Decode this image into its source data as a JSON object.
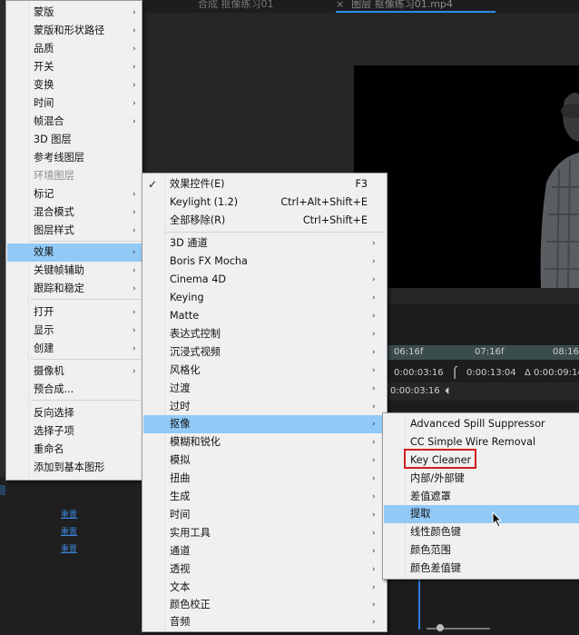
{
  "tabs": {
    "tab1": "合成 抠像练习01",
    "tab2_close": "×",
    "tab2": "图层 抠像练习01.mp4"
  },
  "timeline": {
    "ruler": [
      "06:16f",
      "07:16f",
      "08:16f"
    ],
    "tc_start": "0:00:03:16",
    "tc_end": "0:00:13:04",
    "tc_duration": "Δ 0:00:09:14",
    "tc_current": "0:00:03:16"
  },
  "left_panel": {
    "reset_labels": [
      "重置",
      "重置",
      "重置"
    ]
  },
  "layer_menu": {
    "items": [
      {
        "label": "蒙版"
      },
      {
        "label": "蒙版和形状路径"
      },
      {
        "label": "品质"
      },
      {
        "label": "开关"
      },
      {
        "label": "变换"
      },
      {
        "label": "时间"
      },
      {
        "label": "帧混合"
      },
      {
        "label": "3D 图层"
      },
      {
        "label": "参考线图层"
      },
      {
        "label": "环境图层"
      },
      {
        "label": "标记"
      },
      {
        "label": "混合模式"
      },
      {
        "label": "图层样式"
      },
      {
        "label": "效果"
      },
      {
        "label": "关键帧辅助"
      },
      {
        "label": "跟踪和稳定"
      },
      {
        "label": "打开"
      },
      {
        "label": "显示"
      },
      {
        "label": "创建"
      },
      {
        "label": "摄像机"
      },
      {
        "label": "预合成..."
      },
      {
        "label": "反向选择"
      },
      {
        "label": "选择子项"
      },
      {
        "label": "重命名"
      },
      {
        "label": "添加到基本图形"
      }
    ]
  },
  "effect_menu": {
    "top_items": [
      {
        "label": "效果控件(E)",
        "shortcut": "F3"
      },
      {
        "label": "Keylight (1.2)",
        "shortcut": "Ctrl+Alt+Shift+E"
      },
      {
        "label": "全部移除(R)",
        "shortcut": "Ctrl+Shift+E"
      }
    ],
    "items": [
      {
        "label": "3D 通道"
      },
      {
        "label": "Boris FX Mocha"
      },
      {
        "label": "Cinema 4D"
      },
      {
        "label": "Keying"
      },
      {
        "label": "Matte"
      },
      {
        "label": "表达式控制"
      },
      {
        "label": "沉浸式视频"
      },
      {
        "label": "风格化"
      },
      {
        "label": "过渡"
      },
      {
        "label": "过时"
      },
      {
        "label": "抠像"
      },
      {
        "label": "模糊和锐化"
      },
      {
        "label": "模拟"
      },
      {
        "label": "扭曲"
      },
      {
        "label": "生成"
      },
      {
        "label": "时间"
      },
      {
        "label": "实用工具"
      },
      {
        "label": "通道"
      },
      {
        "label": "透视"
      },
      {
        "label": "文本"
      },
      {
        "label": "颜色校正"
      },
      {
        "label": "音频"
      }
    ]
  },
  "keying_menu": {
    "items": [
      {
        "label": "Advanced Spill Suppressor"
      },
      {
        "label": "CC Simple Wire Removal"
      },
      {
        "label": "Key Cleaner"
      },
      {
        "label": "内部/外部键"
      },
      {
        "label": "差值遮罩"
      },
      {
        "label": "提取"
      },
      {
        "label": "线性颜色键"
      },
      {
        "label": "颜色范围"
      },
      {
        "label": "颜色差值键"
      }
    ]
  },
  "submenu_arrow": "›",
  "checkmark": "✓",
  "colors": {
    "highlight": "#91c9f7",
    "annotation": "#d01d1d",
    "menu_bg": "#f0f0f0"
  }
}
